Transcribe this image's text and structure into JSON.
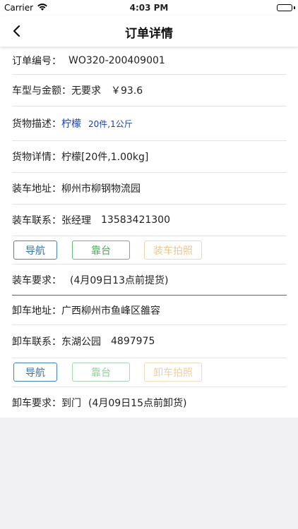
{
  "status_bar": {
    "carrier": "Carrier",
    "time": "4:03 PM"
  },
  "nav": {
    "title": "订单详情"
  },
  "order": {
    "label": "订单编号：",
    "value": "WO320-200409001"
  },
  "vehicle": {
    "label": "车型与金额：",
    "type": "无要求",
    "amount": "￥93.6"
  },
  "goods_desc": {
    "label": "货物描述：",
    "name": "柠檬",
    "qty": "20件,1公斤"
  },
  "goods_detail": {
    "label": "货物详情：",
    "value": "柠檬[20件,1.00kg]"
  },
  "load": {
    "address_label": "装车地址：",
    "address": "柳州市柳钢物流园",
    "contact_label": "装车联系：",
    "contact_name": "张经理",
    "contact_phone": "13583421300",
    "buttons": {
      "navigate": "导航",
      "dock": "靠台",
      "photo": "装车拍照"
    },
    "req_label": "装车要求：",
    "requirement": "(4月09日13点前提货)"
  },
  "unload": {
    "address_label": "卸车地址：",
    "address": "广西柳州市鱼峰区雒容",
    "contact_label": "卸车联系：",
    "contact_name": "东湖公园",
    "contact_phone": "4897975",
    "buttons": {
      "navigate": "导航",
      "dock": "靠台",
      "photo": "卸车拍照"
    },
    "req_label": "卸车要求：",
    "req_type": "到门",
    "requirement": "(4月09日15点前卸货)"
  },
  "colors": {
    "nav_blue": "#2f73c6",
    "dock_green": "#46a856",
    "photo_orange": "#ebc88c",
    "link_blue": "#1a3fc8"
  }
}
